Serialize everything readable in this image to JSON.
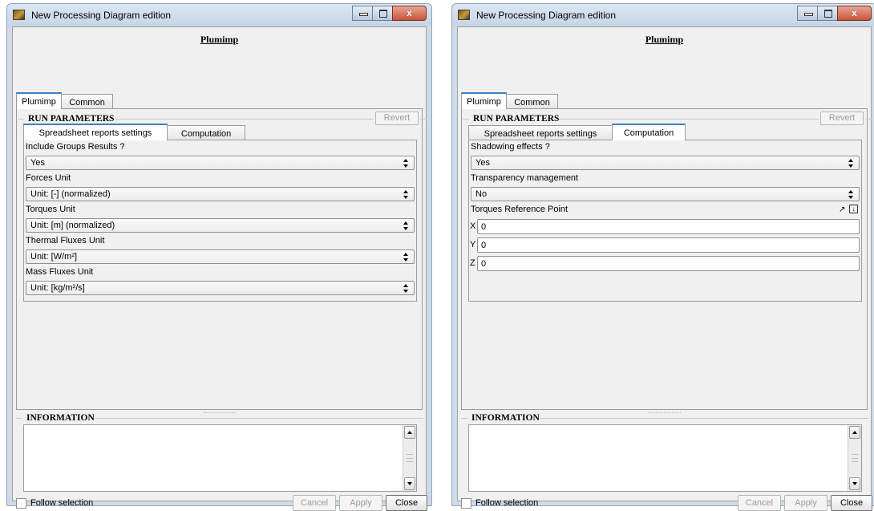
{
  "window_title": "New Processing Diagram edition",
  "close_glyph": "x",
  "page_title": "Plumimp",
  "top_tabs": [
    "Plumimp",
    "Common"
  ],
  "run_parameters": {
    "title": "RUN PARAMETERS",
    "revert_label": "Revert"
  },
  "sub_tabs": [
    "Spreadsheet reports settings",
    "Computation"
  ],
  "spreadsheet": {
    "fields": [
      {
        "label": "Include Groups Results ?",
        "value": "Yes"
      },
      {
        "label": "Forces Unit",
        "value": "Unit: [-] (normalized)"
      },
      {
        "label": "Torques Unit",
        "value": "Unit: [m] (normalized)"
      },
      {
        "label": "Thermal Fluxes Unit",
        "value": "Unit: [W/m²]"
      },
      {
        "label": "Mass Fluxes Unit",
        "value": "Unit: [kg/m²/s]"
      }
    ]
  },
  "computation": {
    "shadowing": {
      "label": "Shadowing effects ?",
      "value": "Yes"
    },
    "transparency": {
      "label": "Transparency management",
      "value": "No"
    },
    "torques_ref": {
      "label": "Torques Reference Point",
      "tool_glyph": "↗",
      "axes": [
        {
          "axis": "X",
          "value": "0"
        },
        {
          "axis": "Y",
          "value": "0"
        },
        {
          "axis": "Z",
          "value": "0"
        }
      ]
    }
  },
  "information": {
    "title": "INFORMATION"
  },
  "follow_selection_label": "Follow selection",
  "buttons": {
    "cancel": "Cancel",
    "apply": "Apply",
    "close": "Close"
  }
}
